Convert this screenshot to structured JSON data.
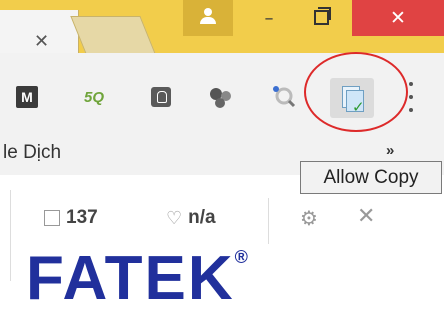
{
  "titlebar": {
    "tab_close_glyph": "✕",
    "window": {
      "minimize_glyph": "–",
      "close_glyph": "✕"
    }
  },
  "extensions": {
    "m_label": "M",
    "five_q_label": "5Q",
    "allow_copy_check": "✓"
  },
  "bookmarks": {
    "partial_item": "le Dịch",
    "overflow_glyph": "»"
  },
  "tooltip": {
    "text": "Allow Copy"
  },
  "stats": {
    "edits": "137",
    "health": "n/a",
    "gear_glyph": "⚙",
    "close_glyph": "✕"
  },
  "logo": {
    "text": "FATEK",
    "registered": "®"
  },
  "colors": {
    "titlebar": "#f2cd4b",
    "close_button": "#e04343",
    "highlight_circle": "#dd2a2a",
    "logo": "#21309c"
  }
}
